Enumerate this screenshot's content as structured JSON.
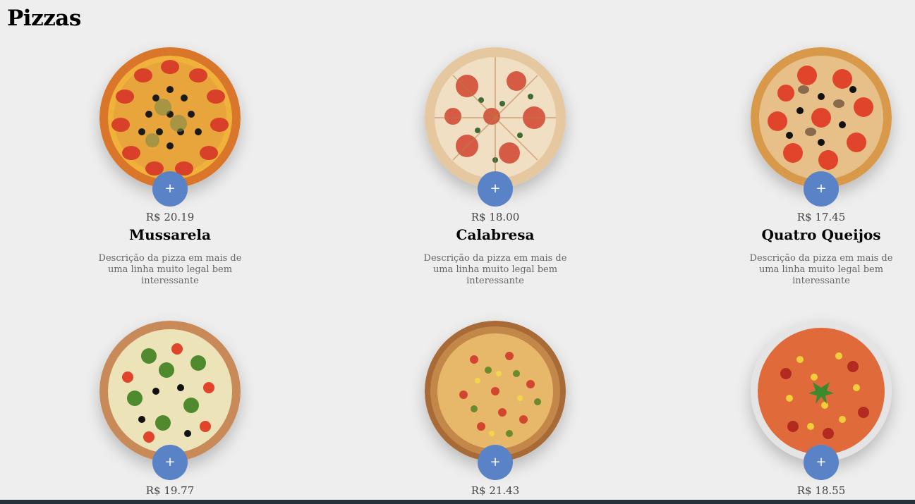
{
  "section": {
    "title": "Pizzas"
  },
  "colors": {
    "accent": "#5a82c7",
    "background": "#eeeeee"
  },
  "pizzas": [
    {
      "price": "R$ 20.19",
      "name": "Mussarela",
      "description": "Descrição da pizza em mais de uma linha muito legal bem interessante",
      "add_label": "+",
      "style": "margherita"
    },
    {
      "price": "R$ 18.00",
      "name": "Calabresa",
      "description": "Descrição da pizza em mais de uma linha muito legal bem interessante",
      "add_label": "+",
      "style": "rustic"
    },
    {
      "price": "R$ 17.45",
      "name": "Quatro Queijos",
      "description": "Descrição da pizza em mais de uma linha muito legal bem interessante",
      "add_label": "+",
      "style": "veggie"
    },
    {
      "price": "R$ 19.77",
      "name": "",
      "description": "",
      "add_label": "+",
      "style": "broccoli"
    },
    {
      "price": "R$ 21.43",
      "name": "",
      "description": "",
      "add_label": "+",
      "style": "board"
    },
    {
      "price": "R$ 18.55",
      "name": "",
      "description": "",
      "add_label": "+",
      "style": "corn"
    }
  ]
}
